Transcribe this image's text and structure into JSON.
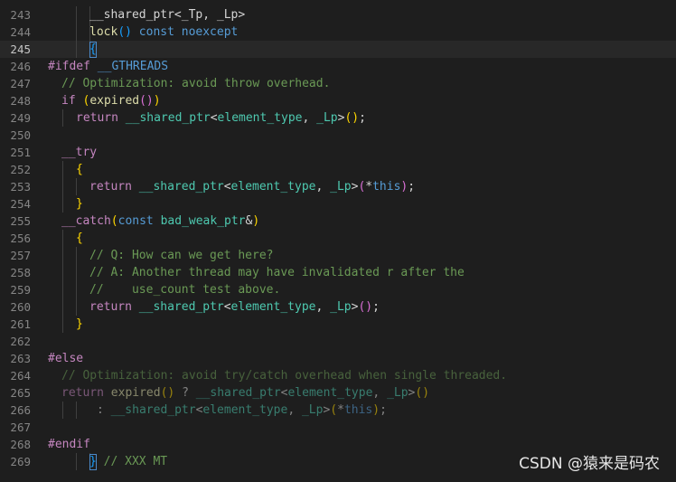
{
  "editor": {
    "lines": [
      {
        "num": "243",
        "guides": [
          3,
          4
        ],
        "segments": [
          {
            "c": "plain",
            "t": "__shared_ptr<_Tp, _Lp>"
          }
        ],
        "indent": 46
      },
      {
        "num": "244",
        "guides": [
          3,
          4
        ],
        "segments": [
          {
            "c": "fn",
            "t": "lock"
          },
          {
            "c": "br3",
            "t": "()"
          },
          {
            "c": "kw",
            "t": " const noexcept"
          }
        ],
        "indent": 46
      },
      {
        "num": "245",
        "guides": [
          3,
          4
        ],
        "current": true,
        "cursor": true,
        "segments": [
          {
            "c": "br3",
            "t": "{"
          }
        ],
        "indent": 46
      },
      {
        "num": "246",
        "segments": [
          {
            "c": "ns",
            "t": "#ifdef "
          },
          {
            "c": "macro",
            "t": "__GTHREADS"
          }
        ],
        "indent": 0
      },
      {
        "num": "247",
        "segments": [
          {
            "c": "cmt",
            "t": "// Optimization: avoid throw overhead."
          }
        ],
        "indent": 15
      },
      {
        "num": "248",
        "segments": [
          {
            "c": "ctrl",
            "t": "if "
          },
          {
            "c": "br1",
            "t": "("
          },
          {
            "c": "fn",
            "t": "expired"
          },
          {
            "c": "br2",
            "t": "()"
          },
          {
            "c": "br1",
            "t": ")"
          }
        ],
        "indent": 15
      },
      {
        "num": "249",
        "guides": [
          1
        ],
        "segments": [
          {
            "c": "ctrl",
            "t": "return "
          },
          {
            "c": "type",
            "t": "__shared_ptr"
          },
          {
            "c": "plain",
            "t": "<"
          },
          {
            "c": "type",
            "t": "element_type"
          },
          {
            "c": "plain",
            "t": ", "
          },
          {
            "c": "type",
            "t": "_Lp"
          },
          {
            "c": "plain",
            "t": ">"
          },
          {
            "c": "br1",
            "t": "()"
          },
          {
            "c": "plain",
            "t": ";"
          }
        ],
        "indent": 31
      },
      {
        "num": "250",
        "segments": [],
        "indent": 0
      },
      {
        "num": "251",
        "segments": [
          {
            "c": "ctrl",
            "t": "__try"
          }
        ],
        "indent": 15
      },
      {
        "num": "252",
        "guides": [
          1
        ],
        "segments": [
          {
            "c": "br1",
            "t": "{"
          }
        ],
        "indent": 31
      },
      {
        "num": "253",
        "guides": [
          1,
          2
        ],
        "segments": [
          {
            "c": "ctrl",
            "t": "return "
          },
          {
            "c": "type",
            "t": "__shared_ptr"
          },
          {
            "c": "plain",
            "t": "<"
          },
          {
            "c": "type",
            "t": "element_type"
          },
          {
            "c": "plain",
            "t": ", "
          },
          {
            "c": "type",
            "t": "_Lp"
          },
          {
            "c": "plain",
            "t": ">"
          },
          {
            "c": "br2",
            "t": "("
          },
          {
            "c": "plain",
            "t": "*"
          },
          {
            "c": "kw",
            "t": "this"
          },
          {
            "c": "br2",
            "t": ")"
          },
          {
            "c": "plain",
            "t": ";"
          }
        ],
        "indent": 46
      },
      {
        "num": "254",
        "guides": [
          1
        ],
        "segments": [
          {
            "c": "br1",
            "t": "}"
          }
        ],
        "indent": 31
      },
      {
        "num": "255",
        "segments": [
          {
            "c": "ctrl",
            "t": "__catch"
          },
          {
            "c": "br1",
            "t": "("
          },
          {
            "c": "kw",
            "t": "const "
          },
          {
            "c": "type",
            "t": "bad_weak_ptr"
          },
          {
            "c": "plain",
            "t": "&"
          },
          {
            "c": "br1",
            "t": ")"
          }
        ],
        "indent": 15
      },
      {
        "num": "256",
        "guides": [
          1
        ],
        "segments": [
          {
            "c": "br1",
            "t": "{"
          }
        ],
        "indent": 31
      },
      {
        "num": "257",
        "guides": [
          1,
          2
        ],
        "segments": [
          {
            "c": "cmt",
            "t": "// Q: How can we get here?"
          }
        ],
        "indent": 46
      },
      {
        "num": "258",
        "guides": [
          1,
          2
        ],
        "segments": [
          {
            "c": "cmt",
            "t": "// A: Another thread may have invalidated r after the"
          }
        ],
        "indent": 46
      },
      {
        "num": "259",
        "guides": [
          1,
          2
        ],
        "segments": [
          {
            "c": "cmt",
            "t": "//    use_count test above."
          }
        ],
        "indent": 46
      },
      {
        "num": "260",
        "guides": [
          1,
          2
        ],
        "segments": [
          {
            "c": "ctrl",
            "t": "return "
          },
          {
            "c": "type",
            "t": "__shared_ptr"
          },
          {
            "c": "plain",
            "t": "<"
          },
          {
            "c": "type",
            "t": "element_type"
          },
          {
            "c": "plain",
            "t": ", "
          },
          {
            "c": "type",
            "t": "_Lp"
          },
          {
            "c": "plain",
            "t": ">"
          },
          {
            "c": "br2",
            "t": "()"
          },
          {
            "c": "plain",
            "t": ";"
          }
        ],
        "indent": 46
      },
      {
        "num": "261",
        "guides": [
          1
        ],
        "segments": [
          {
            "c": "br1",
            "t": "}"
          }
        ],
        "indent": 31
      },
      {
        "num": "262",
        "segments": [],
        "indent": 0
      },
      {
        "num": "263",
        "segments": [
          {
            "c": "ns",
            "t": "#else"
          }
        ],
        "indent": 0
      },
      {
        "num": "264",
        "inactive": true,
        "segments": [
          {
            "c": "cmt",
            "t": "// Optimization: avoid try/catch overhead when single threaded."
          }
        ],
        "indent": 15
      },
      {
        "num": "265",
        "inactive": true,
        "segments": [
          {
            "c": "ctrl",
            "t": "return "
          },
          {
            "c": "fn",
            "t": "expired"
          },
          {
            "c": "br1",
            "t": "()"
          },
          {
            "c": "plain",
            "t": " ? "
          },
          {
            "c": "type",
            "t": "__shared_ptr"
          },
          {
            "c": "plain",
            "t": "<"
          },
          {
            "c": "type",
            "t": "element_type"
          },
          {
            "c": "plain",
            "t": ", "
          },
          {
            "c": "type",
            "t": "_Lp"
          },
          {
            "c": "plain",
            "t": ">"
          },
          {
            "c": "br1",
            "t": "()"
          }
        ],
        "indent": 15
      },
      {
        "num": "266",
        "inactive": true,
        "guides": [
          1,
          2
        ],
        "segments": [
          {
            "c": "plain",
            "t": ": "
          },
          {
            "c": "type",
            "t": "__shared_ptr"
          },
          {
            "c": "plain",
            "t": "<"
          },
          {
            "c": "type",
            "t": "element_type"
          },
          {
            "c": "plain",
            "t": ", "
          },
          {
            "c": "type",
            "t": "_Lp"
          },
          {
            "c": "plain",
            "t": ">"
          },
          {
            "c": "br1",
            "t": "("
          },
          {
            "c": "plain",
            "t": "*"
          },
          {
            "c": "kw",
            "t": "this"
          },
          {
            "c": "br1",
            "t": ")"
          },
          {
            "c": "plain",
            "t": ";"
          }
        ],
        "indent": 54
      },
      {
        "num": "267",
        "segments": [],
        "indent": 0
      },
      {
        "num": "268",
        "segments": [
          {
            "c": "ns",
            "t": "#endif"
          }
        ],
        "indent": 0
      },
      {
        "num": "269",
        "guides": [
          3,
          4
        ],
        "cursorClose": true,
        "segments": [
          {
            "c": "br3",
            "t": "}"
          },
          {
            "c": "cmt",
            "t": " // XXX MT"
          }
        ],
        "indent": 46
      }
    ]
  },
  "watermark": "CSDN @猿来是码农",
  "colors": {
    "background": "#1e1e1e",
    "comment": "#6a9955",
    "keyword": "#569cd6",
    "control": "#c586c0",
    "type": "#4ec9b0",
    "function": "#dcdcaa"
  }
}
